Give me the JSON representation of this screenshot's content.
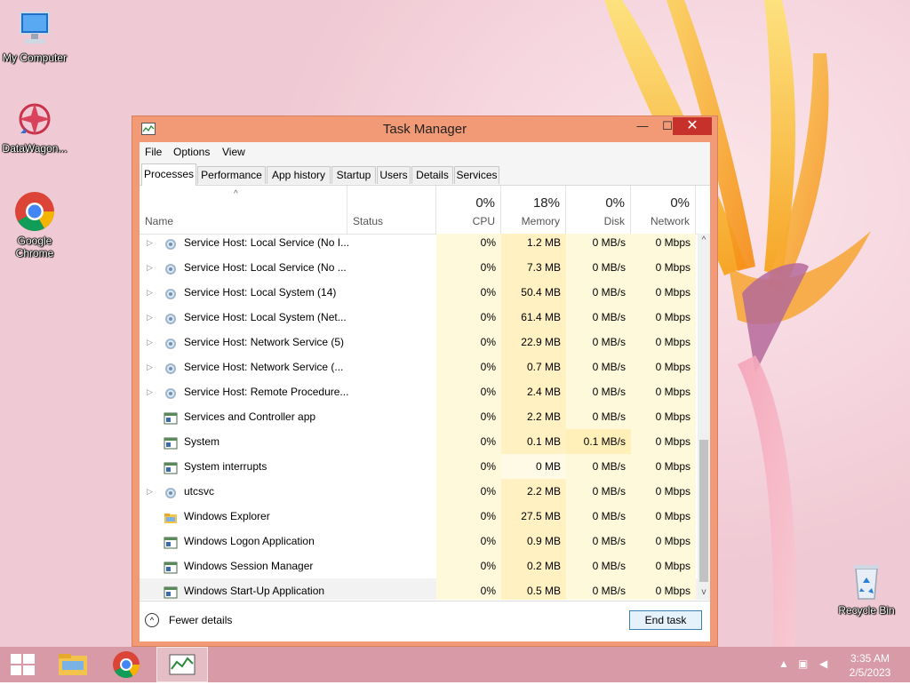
{
  "desktop": {
    "icons": [
      {
        "label": "My Computer"
      },
      {
        "label": "DataWagon..."
      },
      {
        "label": "Google Chrome"
      },
      {
        "label": "Recycle Bin"
      }
    ]
  },
  "window": {
    "title": "Task Manager",
    "controls": {
      "minimize": "—",
      "maximize": "☐",
      "close": "✕"
    }
  },
  "menu": [
    "File",
    "Options",
    "View"
  ],
  "tabs": [
    "Processes",
    "Performance",
    "App history",
    "Startup",
    "Users",
    "Details",
    "Services"
  ],
  "active_tab": "Processes",
  "columns": {
    "name": "Name",
    "status": "Status",
    "cpu": {
      "pct": "0%",
      "label": "CPU"
    },
    "memory": {
      "pct": "18%",
      "label": "Memory"
    },
    "disk": {
      "pct": "0%",
      "label": "Disk"
    },
    "network": {
      "pct": "0%",
      "label": "Network"
    }
  },
  "processes": [
    {
      "name": "Service Host: Local Service (No I...",
      "cpu": "0%",
      "memory": "1.2 MB",
      "disk": "0 MB/s",
      "network": "0 Mbps",
      "expandable": true,
      "icon": "gear-icon"
    },
    {
      "name": "Service Host: Local Service (No ...",
      "cpu": "0%",
      "memory": "7.3 MB",
      "disk": "0 MB/s",
      "network": "0 Mbps",
      "expandable": true,
      "icon": "gear-icon"
    },
    {
      "name": "Service Host: Local System (14)",
      "cpu": "0%",
      "memory": "50.4 MB",
      "disk": "0 MB/s",
      "network": "0 Mbps",
      "expandable": true,
      "icon": "gear-icon"
    },
    {
      "name": "Service Host: Local System (Net...",
      "cpu": "0%",
      "memory": "61.4 MB",
      "disk": "0 MB/s",
      "network": "0 Mbps",
      "expandable": true,
      "icon": "gear-icon"
    },
    {
      "name": "Service Host: Network Service (5)",
      "cpu": "0%",
      "memory": "22.9 MB",
      "disk": "0 MB/s",
      "network": "0 Mbps",
      "expandable": true,
      "icon": "gear-icon"
    },
    {
      "name": "Service Host: Network Service (...",
      "cpu": "0%",
      "memory": "0.7 MB",
      "disk": "0 MB/s",
      "network": "0 Mbps",
      "expandable": true,
      "icon": "gear-icon"
    },
    {
      "name": "Service Host: Remote Procedure...",
      "cpu": "0%",
      "memory": "2.4 MB",
      "disk": "0 MB/s",
      "network": "0 Mbps",
      "expandable": true,
      "icon": "gear-icon"
    },
    {
      "name": "Services and Controller app",
      "cpu": "0%",
      "memory": "2.2 MB",
      "disk": "0 MB/s",
      "network": "0 Mbps",
      "expandable": false,
      "icon": "app-window-icon"
    },
    {
      "name": "System",
      "cpu": "0%",
      "memory": "0.1 MB",
      "disk": "0.1 MB/s",
      "network": "0 Mbps",
      "expandable": false,
      "icon": "app-window-icon"
    },
    {
      "name": "System interrupts",
      "cpu": "0%",
      "memory": "0 MB",
      "disk": "0 MB/s",
      "network": "0 Mbps",
      "expandable": false,
      "icon": "app-window-icon"
    },
    {
      "name": "utcsvc",
      "cpu": "0%",
      "memory": "2.2 MB",
      "disk": "0 MB/s",
      "network": "0 Mbps",
      "expandable": true,
      "icon": "gear-icon"
    },
    {
      "name": "Windows Explorer",
      "cpu": "0%",
      "memory": "27.5 MB",
      "disk": "0 MB/s",
      "network": "0 Mbps",
      "expandable": false,
      "icon": "folder-icon"
    },
    {
      "name": "Windows Logon Application",
      "cpu": "0%",
      "memory": "0.9 MB",
      "disk": "0 MB/s",
      "network": "0 Mbps",
      "expandable": false,
      "icon": "app-window-icon"
    },
    {
      "name": "Windows Session Manager",
      "cpu": "0%",
      "memory": "0.2 MB",
      "disk": "0 MB/s",
      "network": "0 Mbps",
      "expandable": false,
      "icon": "app-window-icon"
    },
    {
      "name": "Windows Start-Up Application",
      "cpu": "0%",
      "memory": "0.5 MB",
      "disk": "0 MB/s",
      "network": "0 Mbps",
      "expandable": false,
      "icon": "app-window-icon",
      "selected": true
    }
  ],
  "footer": {
    "fewer_details": "Fewer details",
    "end_task": "End task"
  },
  "taskbar": {
    "clock_time": "3:35 AM",
    "clock_date": "2/5/2023"
  },
  "colors": {
    "window_border": "#f29a76",
    "close_button": "#c7312b",
    "taskbar": "#d89aa6"
  }
}
